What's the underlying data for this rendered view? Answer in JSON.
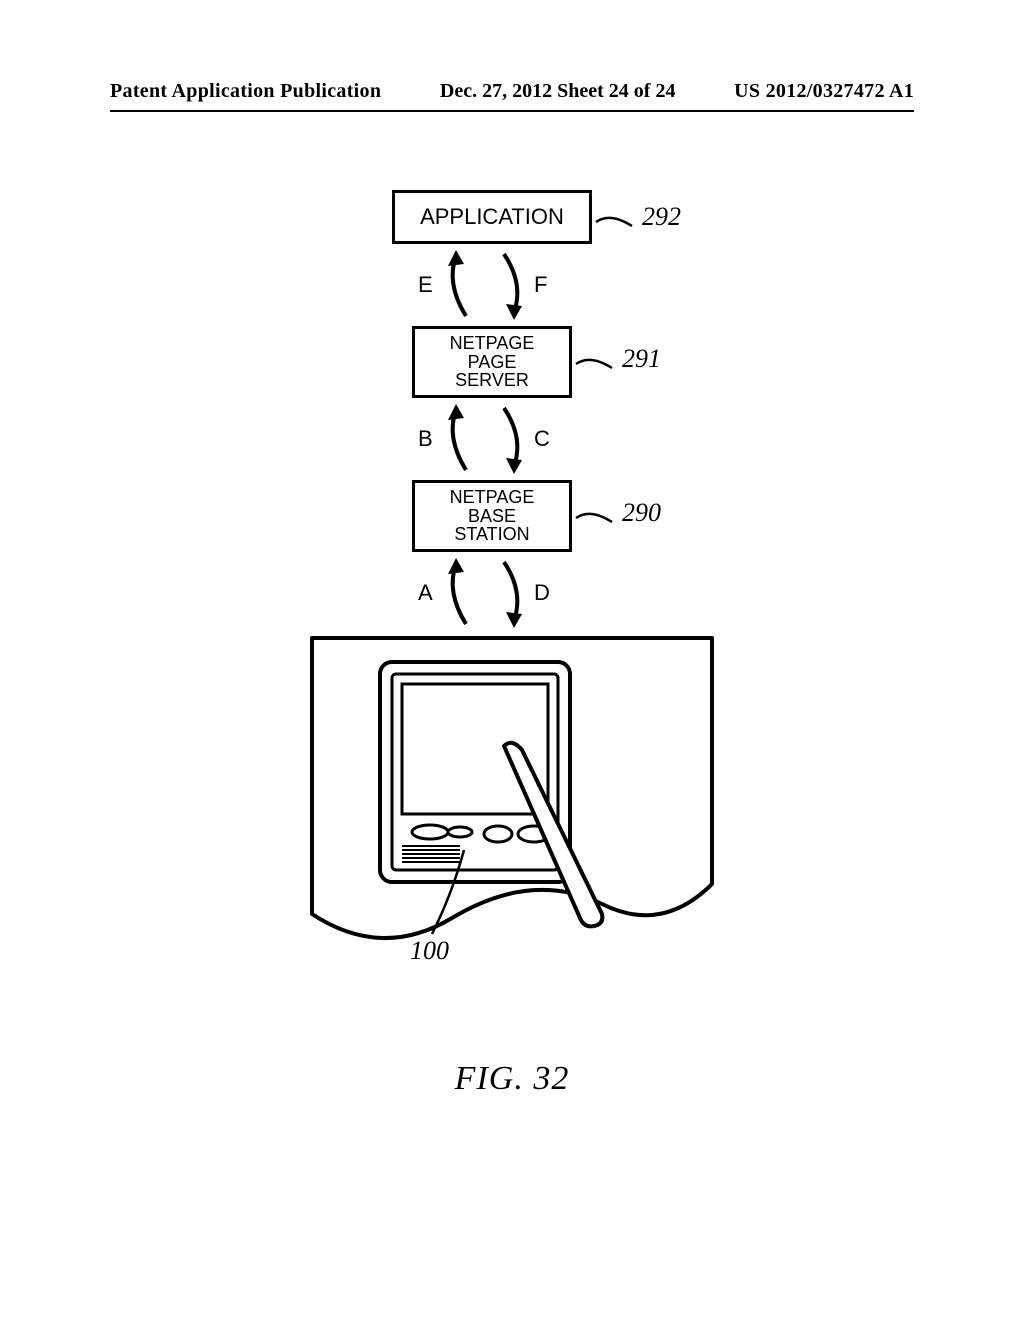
{
  "header": {
    "left": "Patent Application Publication",
    "center": "Dec. 27, 2012  Sheet 24 of 24",
    "right": "US 2012/0327472 A1"
  },
  "figure": {
    "caption": "FIG. 32",
    "blocks": {
      "application": {
        "label": "APPLICATION",
        "ref": "292"
      },
      "page_server": {
        "line1": "NETPAGE",
        "line2": "PAGE",
        "line3": "SERVER",
        "ref": "291"
      },
      "base_station": {
        "line1": "NETPAGE",
        "line2": "BASE",
        "line3": "STATION",
        "ref": "290"
      },
      "device": {
        "ref": "100"
      }
    },
    "edges": {
      "E": "E",
      "F": "F",
      "B": "B",
      "C": "C",
      "A": "A",
      "D": "D"
    }
  }
}
